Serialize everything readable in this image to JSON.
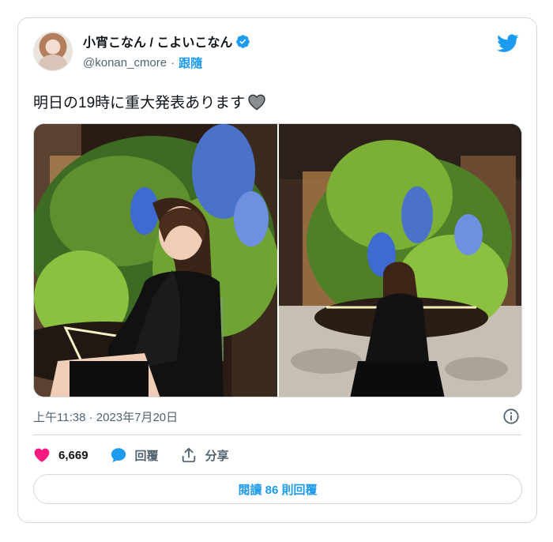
{
  "author": {
    "display_name": "小宵こなん / こよいこなん",
    "handle": "@konan_cmore",
    "separator": "·",
    "follow_label": "跟隨"
  },
  "tweet": {
    "text": "明日の19時に重大発表あります",
    "emoji": "grey-heart-icon"
  },
  "timestamp": "上午11:38 · 2023年7月20日",
  "actions": {
    "likes_count": "6,669",
    "reply_label": "回覆",
    "share_label": "分享"
  },
  "read_replies_label": "閱讀 86 則回覆",
  "colors": {
    "accent": "#1d9bf0",
    "like": "#f91880",
    "text_secondary": "#536471",
    "border": "#cfd9de"
  }
}
